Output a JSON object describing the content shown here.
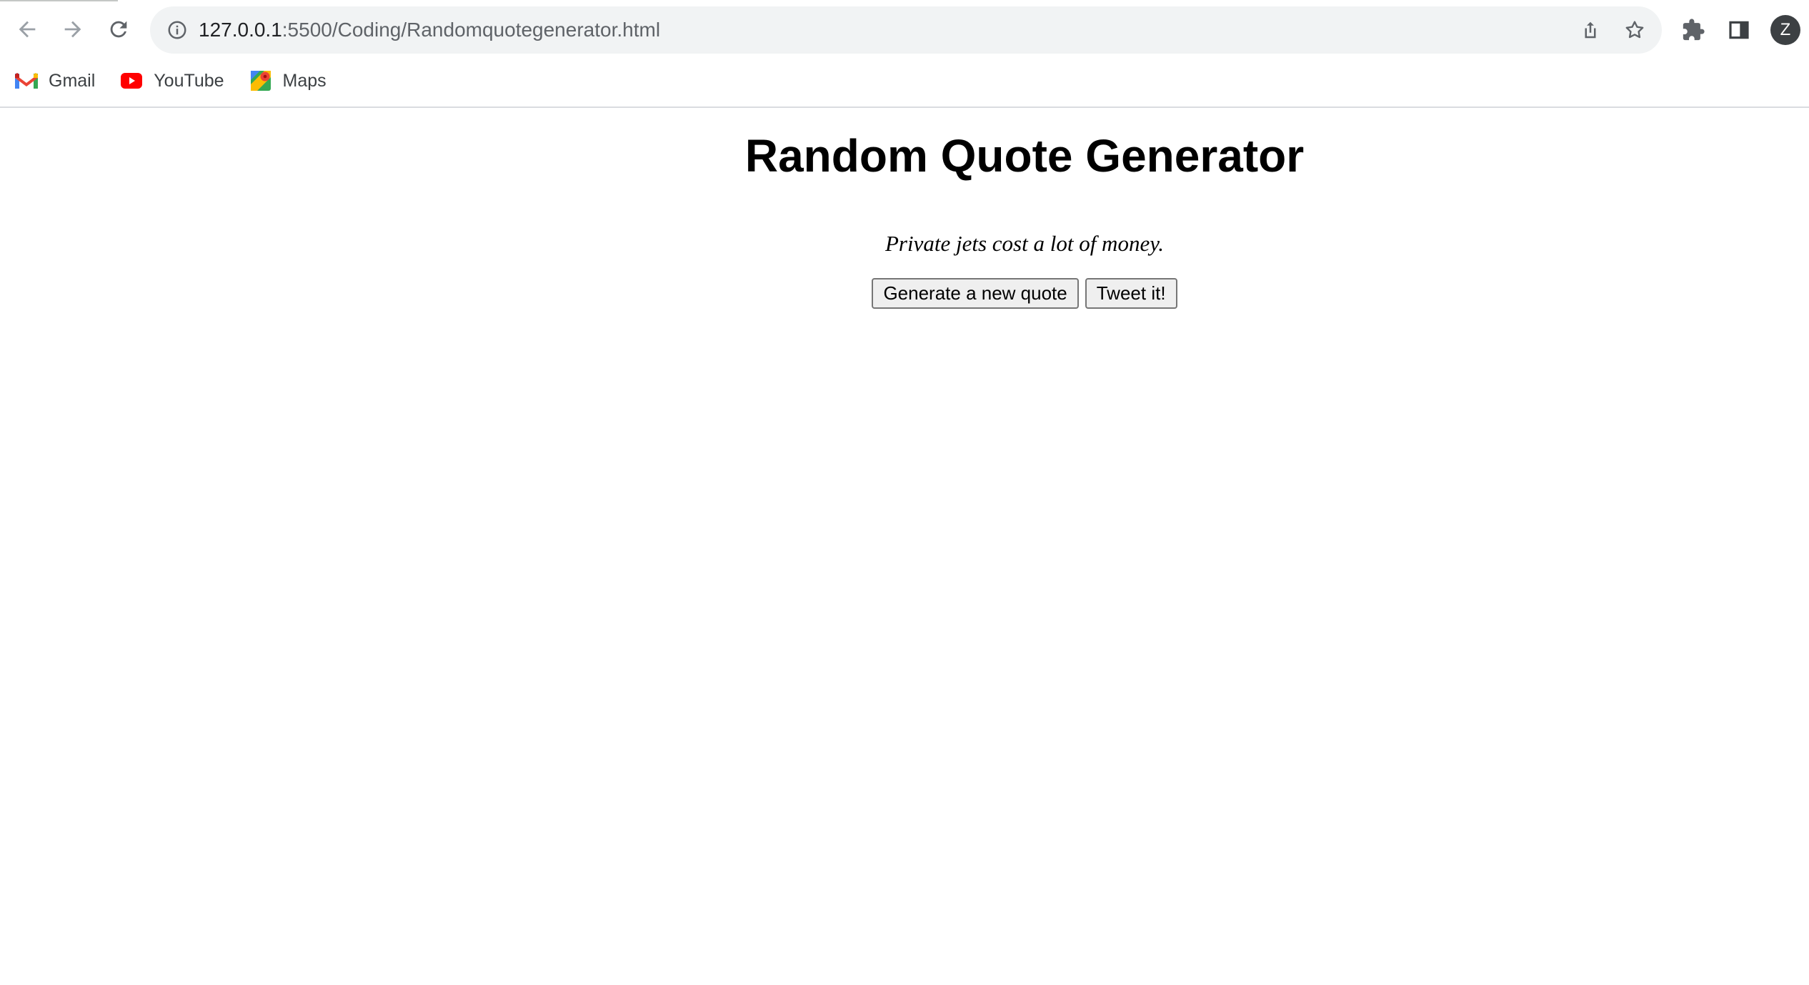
{
  "browser": {
    "url_host": "127.0.0.1",
    "url_rest": ":5500/Coding/Randomquotegenerator.html",
    "profile_initial": "Z",
    "icons": {
      "back": "back-arrow-icon",
      "forward": "forward-arrow-icon",
      "reload": "reload-icon",
      "site_info": "info-icon",
      "share": "share-icon",
      "bookmark_star": "star-icon",
      "extensions": "puzzle-icon",
      "side_panel": "side-panel-icon"
    }
  },
  "bookmarks": [
    {
      "label": "Gmail",
      "icon": "gmail-icon"
    },
    {
      "label": "YouTube",
      "icon": "youtube-icon"
    },
    {
      "label": "Maps",
      "icon": "maps-icon"
    }
  ],
  "page": {
    "title": "Random Quote Generator",
    "quote": "Private jets cost a lot of money.",
    "generate_label": "Generate a new quote",
    "tweet_label": "Tweet it!"
  },
  "colors": {
    "omnibox_bg": "#f1f3f4",
    "avatar_bg": "#3c4043",
    "youtube_red": "#ff0000",
    "gmail_red": "#ea4335"
  }
}
